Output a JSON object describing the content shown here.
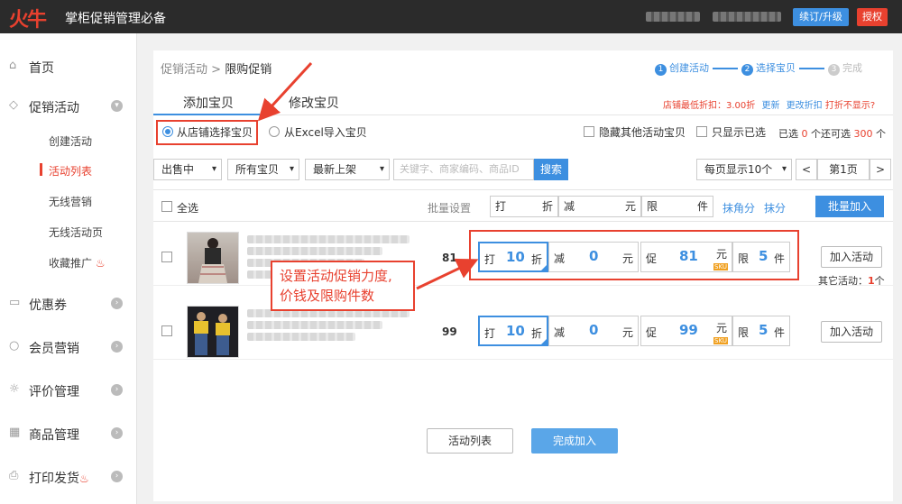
{
  "header": {
    "logo": "火牛",
    "app_name": "掌柜促销管理必备",
    "renew_label": "续订/升级",
    "auth_label": "授权"
  },
  "sidebar": {
    "home": "首页",
    "promo": "促销活动",
    "promo_sub": [
      "创建活动",
      "活动列表",
      "无线营销",
      "无线活动页",
      "收藏推广"
    ],
    "coupon": "优惠券",
    "member": "会员营销",
    "review": "评价管理",
    "goods": "商品管理",
    "print": "打印发货"
  },
  "breadcrumb": {
    "parent": "促销活动",
    "sep": ">",
    "current": "限购促销"
  },
  "steps": [
    "创建活动",
    "选择宝贝",
    "完成"
  ],
  "step_nums": [
    "1",
    "2",
    "3"
  ],
  "tabs": {
    "add": "添加宝贝",
    "edit": "修改宝贝"
  },
  "discount_note": {
    "text": "店铺最低折扣：3.00折",
    "update": "更新",
    "change": "更改折扣",
    "hidden": "打折不显示?"
  },
  "source": {
    "from_shop": "从店铺选择宝贝",
    "from_excel": "从Excel导入宝贝"
  },
  "options": {
    "hide_other": "隐藏其他活动宝贝",
    "show_selected": "只显示已选",
    "selected_label": "已选",
    "selected_count": "0",
    "selected_unit": "个",
    "remaining_label": "还可选",
    "remaining_count": "300",
    "remaining_unit": "个"
  },
  "filters": {
    "status": "出售中",
    "category": "所有宝贝",
    "sort": "最新上架",
    "search_placeholder": "关键字、商家编码、商品ID",
    "search_button": "搜索",
    "per_page": "每页显示10个",
    "prev": "<",
    "page": "第1页",
    "next": ">"
  },
  "table_head": {
    "select_all": "全选",
    "bulk_setting": "批量设置",
    "discount_l": "打",
    "discount_r": "折",
    "reduce_l": "减",
    "reduce_r": "元",
    "limit_l": "限",
    "limit_r": "件",
    "round_jiao": "抹角分",
    "round_fen": "抹分",
    "batch_add": "批量加入"
  },
  "rows": [
    {
      "price": "81",
      "d_l": "打",
      "discount": "10",
      "d_r": "折",
      "r_l": "减",
      "reduce": "0",
      "r_r": "元",
      "p_l": "促",
      "promo": "81",
      "p_r": "元",
      "sku": "SKU",
      "lim_l": "限",
      "limit": "5",
      "lim_r": "件",
      "add": "加入活动",
      "other_label": "其它活动：",
      "other_count": "1",
      "other_unit": "个"
    },
    {
      "price": "99",
      "d_l": "打",
      "discount": "10",
      "d_r": "折",
      "r_l": "减",
      "reduce": "0",
      "r_r": "元",
      "p_l": "促",
      "promo": "99",
      "p_r": "元",
      "sku": "SKU",
      "lim_l": "限",
      "limit": "5",
      "lim_r": "件",
      "add": "加入活动"
    }
  ],
  "callout": {
    "line1": "设置活动促销力度,",
    "line2": "价钱及限购件数"
  },
  "footer": {
    "list_button": "活动列表",
    "finish_button": "完成加入"
  },
  "colors": {
    "accent": "#3d8fe0",
    "alert": "#e8412f",
    "dark_bar": "#2b2b2b"
  }
}
